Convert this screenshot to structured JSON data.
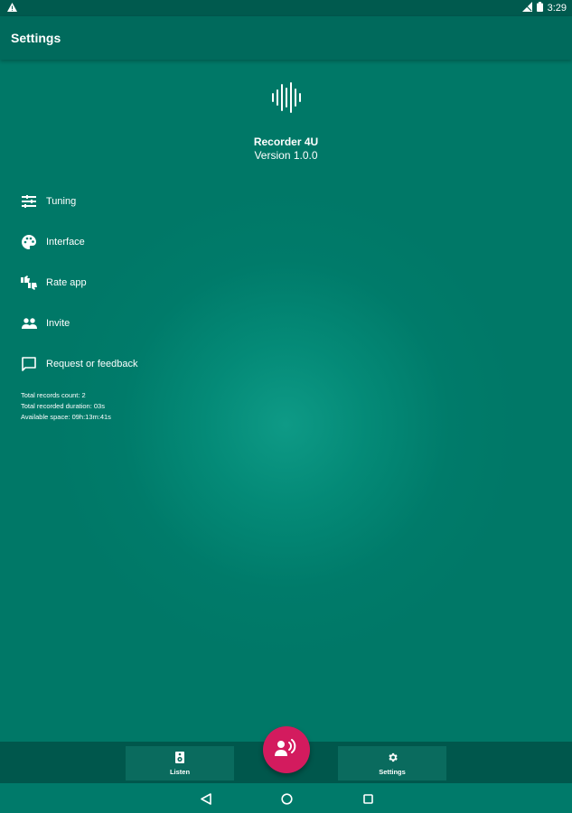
{
  "status_bar": {
    "icons": [
      "warning-icon",
      "signal-icon",
      "battery-icon"
    ],
    "time": "3:29"
  },
  "app_bar": {
    "title": "Settings"
  },
  "about": {
    "icon": "waveform-icon",
    "app_name": "Recorder 4U",
    "version": "Version 1.0.0"
  },
  "menu": [
    {
      "label": "Tuning",
      "icon": "tune-icon"
    },
    {
      "label": "Interface",
      "icon": "palette-icon"
    },
    {
      "label": "Rate app",
      "icon": "thumbs-icon"
    },
    {
      "label": "Invite",
      "icon": "people-icon"
    },
    {
      "label": "Request or feedback",
      "icon": "feedback-icon"
    }
  ],
  "stats": {
    "records_count": "Total records count: 2",
    "recorded_duration": "Total recorded duration: 03s",
    "available_space": "Available space: 09h:13m:41s"
  },
  "bottom_nav": {
    "listen_label": "Listen",
    "settings_label": "Settings",
    "fab_icon": "record-voice-icon"
  },
  "colors": {
    "background": "#007867",
    "app_bar": "#006a5c",
    "accent": "#d31b5e"
  }
}
